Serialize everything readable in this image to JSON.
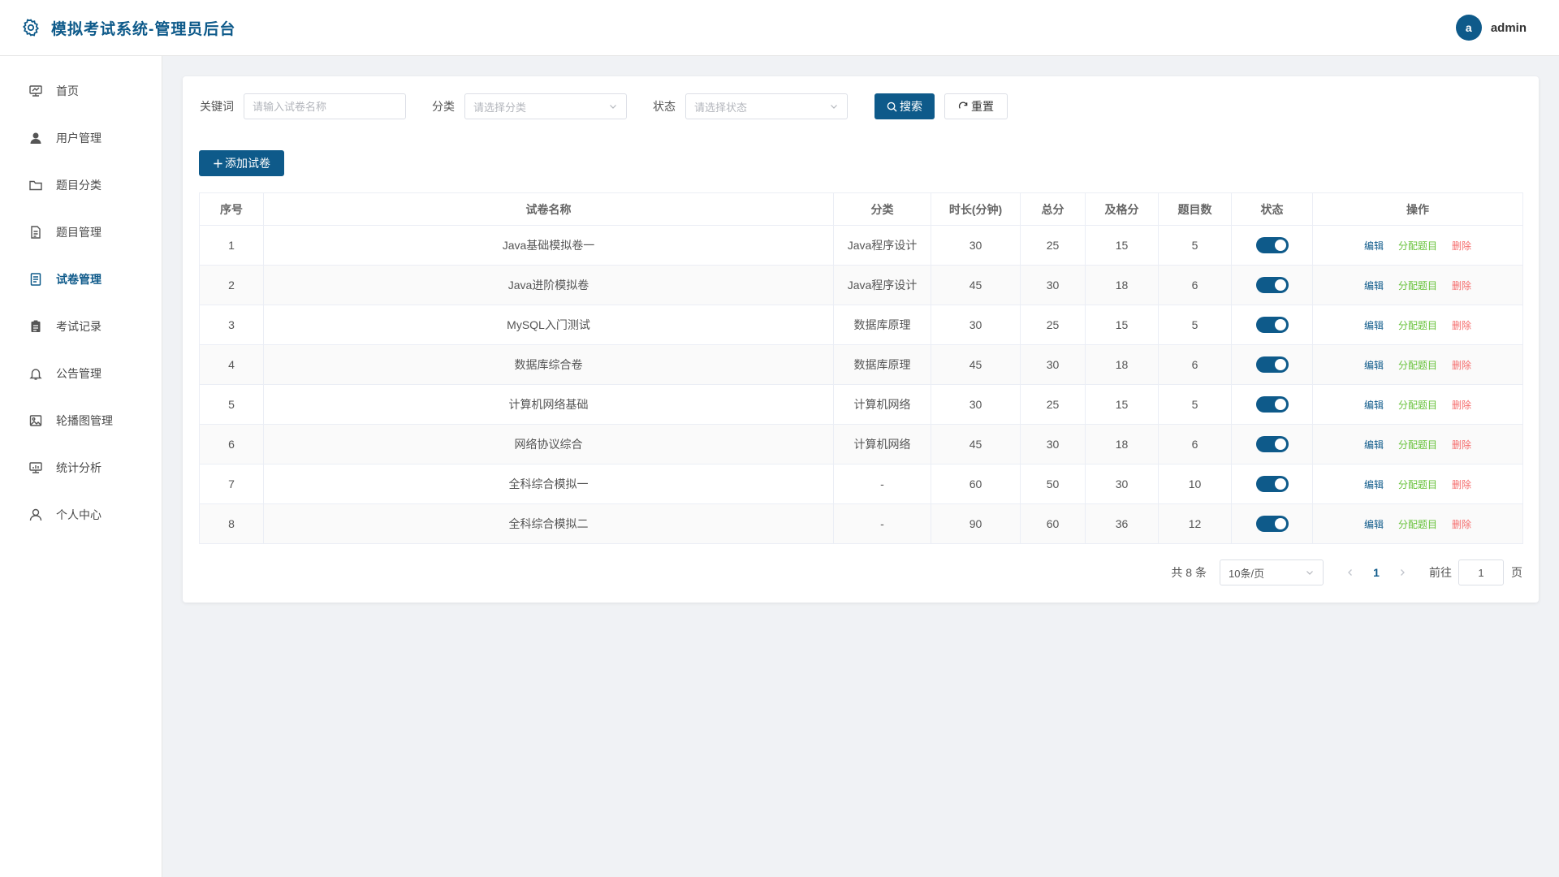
{
  "header": {
    "title": "模拟考试系统-管理员后台",
    "avatar_letter": "a",
    "username": "admin",
    "brand_icon": "gear-icon"
  },
  "colors": {
    "primary": "#0e5a8a",
    "success": "#67c23a",
    "danger": "#f56c6c"
  },
  "sidebar": {
    "items": [
      {
        "label": "首页",
        "icon": "dashboard-icon"
      },
      {
        "label": "用户管理",
        "icon": "user-icon"
      },
      {
        "label": "题目分类",
        "icon": "folder-icon"
      },
      {
        "label": "题目管理",
        "icon": "document-icon"
      },
      {
        "label": "试卷管理",
        "icon": "paper-icon",
        "active": true
      },
      {
        "label": "考试记录",
        "icon": "clipboard-icon"
      },
      {
        "label": "公告管理",
        "icon": "bell-icon"
      },
      {
        "label": "轮播图管理",
        "icon": "picture-icon"
      },
      {
        "label": "统计分析",
        "icon": "chart-icon"
      },
      {
        "label": "个人中心",
        "icon": "person-icon"
      }
    ]
  },
  "filters": {
    "keyword_label": "关键词",
    "keyword_placeholder": "请输入试卷名称",
    "category_label": "分类",
    "category_placeholder": "请选择分类",
    "status_label": "状态",
    "status_placeholder": "请选择状态",
    "search_label": "搜索",
    "reset_label": "重置"
  },
  "toolbar": {
    "add_label": "添加试卷"
  },
  "table": {
    "headers": [
      "序号",
      "试卷名称",
      "分类",
      "时长(分钟)",
      "总分",
      "及格分",
      "题目数",
      "状态",
      "操作"
    ],
    "actions": {
      "edit": "编辑",
      "assign": "分配题目",
      "delete": "删除"
    },
    "rows": [
      {
        "index": "1",
        "name": "Java基础模拟卷一",
        "category": "Java程序设计",
        "duration": "30",
        "total": "25",
        "pass": "15",
        "count": "5",
        "enabled": true
      },
      {
        "index": "2",
        "name": "Java进阶模拟卷",
        "category": "Java程序设计",
        "duration": "45",
        "total": "30",
        "pass": "18",
        "count": "6",
        "enabled": true
      },
      {
        "index": "3",
        "name": "MySQL入门测试",
        "category": "数据库原理",
        "duration": "30",
        "total": "25",
        "pass": "15",
        "count": "5",
        "enabled": true
      },
      {
        "index": "4",
        "name": "数据库综合卷",
        "category": "数据库原理",
        "duration": "45",
        "total": "30",
        "pass": "18",
        "count": "6",
        "enabled": true
      },
      {
        "index": "5",
        "name": "计算机网络基础",
        "category": "计算机网络",
        "duration": "30",
        "total": "25",
        "pass": "15",
        "count": "5",
        "enabled": true
      },
      {
        "index": "6",
        "name": "网络协议综合",
        "category": "计算机网络",
        "duration": "45",
        "total": "30",
        "pass": "18",
        "count": "6",
        "enabled": true
      },
      {
        "index": "7",
        "name": "全科综合模拟一",
        "category": "-",
        "duration": "60",
        "total": "50",
        "pass": "30",
        "count": "10",
        "enabled": true
      },
      {
        "index": "8",
        "name": "全科综合模拟二",
        "category": "-",
        "duration": "90",
        "total": "60",
        "pass": "36",
        "count": "12",
        "enabled": true
      }
    ]
  },
  "pagination": {
    "total_text": "共 8 条",
    "page_size": "10条/页",
    "current_page": "1",
    "goto_label": "前往",
    "goto_value": "1",
    "page_unit": "页"
  }
}
